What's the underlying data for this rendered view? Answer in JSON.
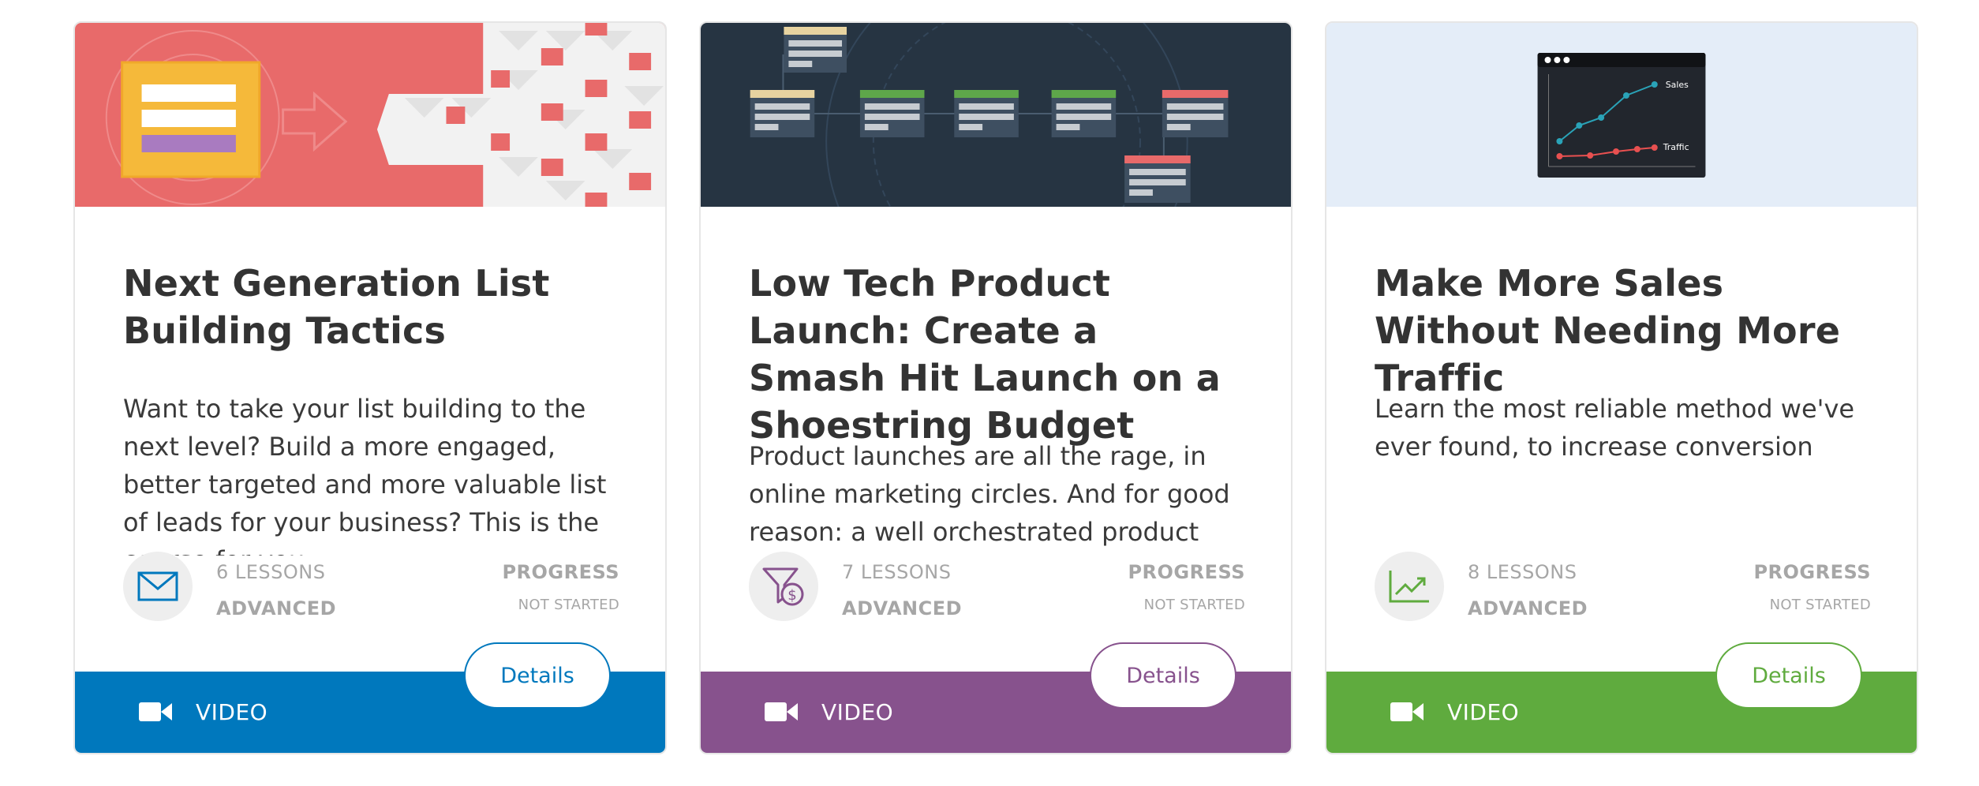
{
  "courses": [
    {
      "title": "Next Generation List Building Tactics",
      "description": "Want to take your list building to the next level? Build a more engaged, better targeted and more valuable list of leads for your business? This is the course for you.",
      "lessons": "6 LESSONS",
      "level": "ADVANCED",
      "progress_label": "PROGRESS",
      "progress_status": "NOT STARTED",
      "media_type": "VIDEO",
      "details_label": "Details",
      "badge_icon": "envelope-icon",
      "accent_color": "#0078bd"
    },
    {
      "title": "Low Tech Product Launch: Create a Smash Hit Launch on a Shoestring Budget",
      "description": "Product launches are all the rage, in online marketing circles. And for good reason: a well orchestrated product launch can make a lot of sales.",
      "lessons": "7 LESSONS",
      "level": "ADVANCED",
      "progress_label": "PROGRESS",
      "progress_status": "NOT STARTED",
      "media_type": "VIDEO",
      "details_label": "Details",
      "badge_icon": "funnel-dollar-icon",
      "accent_color": "#87528d"
    },
    {
      "title": "Make More Sales Without Needing More Traffic",
      "description": "Learn the most reliable method we've ever found, to increase conversion rates.",
      "lessons": "8 LESSONS",
      "level": "ADVANCED",
      "progress_label": "PROGRESS",
      "progress_status": "NOT STARTED",
      "media_type": "VIDEO",
      "details_label": "Details",
      "badge_icon": "trend-chart-icon",
      "accent_color": "#5fab3e",
      "thumbnail_labels": {
        "sales": "Sales",
        "traffic": "Traffic"
      }
    }
  ]
}
